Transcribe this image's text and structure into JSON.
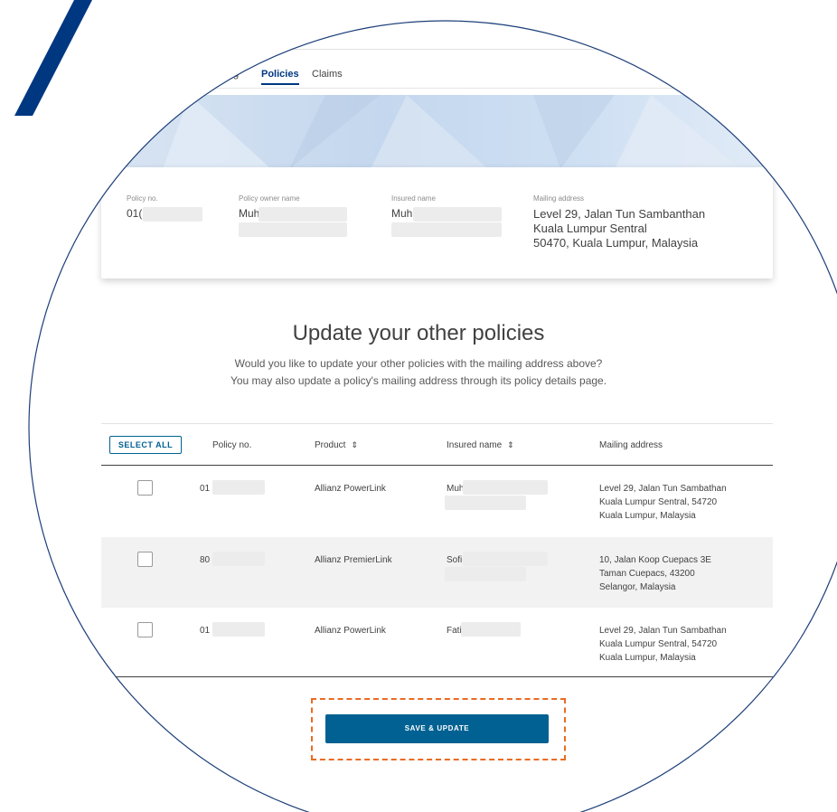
{
  "tabs": [
    {
      "label": "g"
    },
    {
      "label": "Policies"
    },
    {
      "label": "Claims"
    }
  ],
  "card": {
    "policy_no_label": "Policy no.",
    "policy_no_value": "01(",
    "owner_label": "Policy owner name",
    "owner_value": "Muh",
    "insured_label": "Insured name",
    "insured_value": "Muh",
    "mailing_label": "Mailing address",
    "mailing_line1": "Level 29, Jalan Tun Sambanthan",
    "mailing_line2": "Kuala Lumpur Sentral",
    "mailing_line3": "50470, Kuala Lumpur, Malaysia"
  },
  "section": {
    "heading": "Update your other policies",
    "sub_line1": "Would you like to update your other policies with the mailing address above?",
    "sub_line2": "You may also update a policy's mailing address through its policy details page."
  },
  "table": {
    "select_all": "SELECT ALL",
    "headers": [
      "Policy no.",
      "Product",
      "Insured name",
      "Mailing address"
    ],
    "sort_icon": "⇕",
    "rows": [
      {
        "policy": "01",
        "product": "Allianz PowerLink",
        "insured": "Muh",
        "addr1": "Level 29, Jalan Tun Sambathan",
        "addr2": "Kuala Lumpur Sentral, 54720",
        "addr3": "Kuala Lumpur, Malaysia"
      },
      {
        "policy": "80",
        "product": "Allianz PremierLink",
        "insured": "Sofi",
        "addr1": "10, Jalan Koop Cuepacs 3E",
        "addr2": "Taman Cuepacs, 43200",
        "addr3": "Selangor, Malaysia"
      },
      {
        "policy": "01",
        "product": "Allianz PowerLink",
        "insured": "Fati",
        "addr1": "Level 29, Jalan Tun Sambathan",
        "addr2": "Kuala Lumpur Sentral, 54720",
        "addr3": "Kuala Lumpur, Malaysia"
      }
    ]
  },
  "save_button": "SAVE & UPDATE",
  "colors": {
    "brand_blue": "#003781",
    "button_blue": "#006192",
    "highlight_orange": "#ea6b23"
  }
}
